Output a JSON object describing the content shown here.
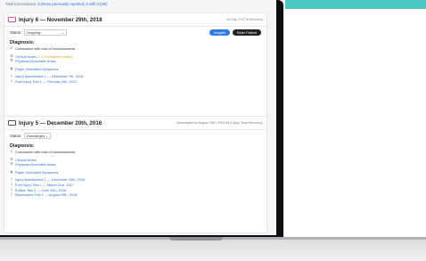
{
  "topline": {
    "prefix": "Total Concussions:",
    "count": "8",
    "note": "(None previously reported, 8 with CCMI)"
  },
  "injury6": {
    "title": "Injury 6 — November 29th, 2018",
    "meta": "On Day 1727 of Recovery",
    "status_label": "Status:",
    "status_value": "Ongoing",
    "insights_label": "Insights",
    "refer_label": "Refer Patient",
    "diagnosis_heading": "Diagnosis:",
    "diagnosis": "Concussion with loss of consciousness",
    "notes": [
      {
        "label": "Clinical Notes",
        "warning": "1 incomplete note(s)"
      },
      {
        "label": "Physician/Specialist Notes"
      }
    ],
    "symptoms": "Paper Submitted Symptoms",
    "tests": [
      "Injury Assessment 1 — December 7th, 2018",
      "Post Injury Test 1 — February 6th, 2023"
    ]
  },
  "injury5": {
    "title": "Injury 5 — December 20th, 2016",
    "meta": "Discharged on August 29th, 2016 (613 Days Total Recovery)",
    "status_label": "Status:",
    "status_value": "Discharged",
    "diagnosis_heading": "Diagnosis:",
    "diagnosis": "Concussion with loss of consciousness",
    "notes": [
      "Clinical Notes",
      "Physician/Specialist Notes"
    ],
    "symptoms": "Paper Submitted Symptoms",
    "tests": [
      "Injury Assessment 1 — December 20th, 2016",
      "Post Injury Test 1 — March 21st, 2017",
      "Buffalo Test 1 — June 20th, 2018",
      "Blackhawks Test 1 — August 29th, 2018"
    ]
  },
  "colors": {
    "accent": "#2d7de0",
    "link": "#2f6fd6",
    "folder": "#e0559a",
    "warning": "#e09a1a",
    "brand_band": "#4dc7c1"
  },
  "icons": {
    "folder": "folder-icon",
    "check": "check-icon",
    "notes": "list-icon",
    "symptoms": "bookmark-icon",
    "test": "document-icon",
    "chevron": "chevron-down-icon"
  }
}
